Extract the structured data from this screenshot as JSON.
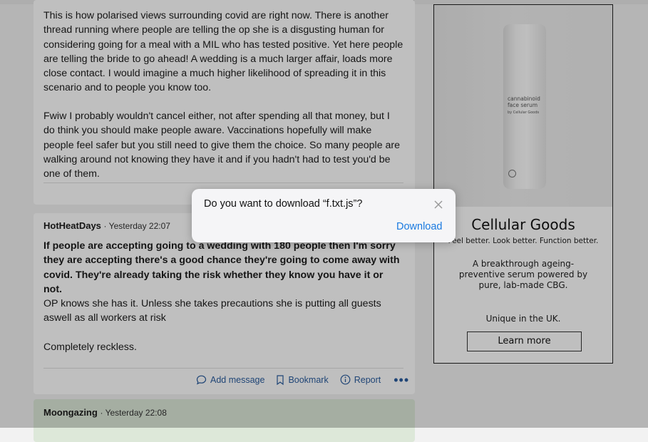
{
  "post1": {
    "paragraph1": "This is how polarised views surrounding covid are right now. There is another thread running where people are telling the op she is a disgusting human for considering going for a meal with a MIL who has tested positive. Yet here people are telling the bride to go ahead! A wedding is a much larger affair, loads more close contact. I would imagine a much higher likelihood of spreading it in this scenario and to people you know too.",
    "paragraph2": "Fwiw I probably wouldn't cancel either, not after spending all that money, but I do think you should make people aware. Vaccinations hopefully will make people feel safer but you still need to give them the choice. So many people are walking around not knowing they have it and if you hadn't had to test you'd be one of them."
  },
  "post2": {
    "author": "HotHeatDays",
    "time": "Yesterday 22:07",
    "quote": "If people are accepting going to a wedding with 180 people then I'm sorry they are accepting there's a good chance they're going to come away with covid. They're already taking the risk whether they know you have it or not.",
    "paragraph1": "OP knows she has it. Unless she takes precautions she is putting all guests aswell as all workers at risk",
    "paragraph2": "Completely reckless.",
    "actions": {
      "add_message": "Add message",
      "bookmark": "Bookmark",
      "report": "Report",
      "more": "•••"
    }
  },
  "post3": {
    "author": "Moongazing",
    "time": "Yesterday 22:08"
  },
  "ad": {
    "bottle_text": "cannabinoid face serum",
    "bottle_subtext": "by Cellular Goods",
    "brand": "Cellular Goods",
    "tagline": "Feel better. Look better. Function better.",
    "description": "A breakthrough ageing-preventive serum powered by pure, lab-made CBG.",
    "unique": "Unique in the UK.",
    "cta": "Learn more"
  },
  "dialog": {
    "message": "Do you want to download “f.txt.js”?",
    "download_label": "Download",
    "close_icon": "close-icon"
  },
  "colors": {
    "link": "#2a5c9e",
    "dialog_action": "#1a7ae0",
    "highlight_post": "#dde8d9"
  }
}
